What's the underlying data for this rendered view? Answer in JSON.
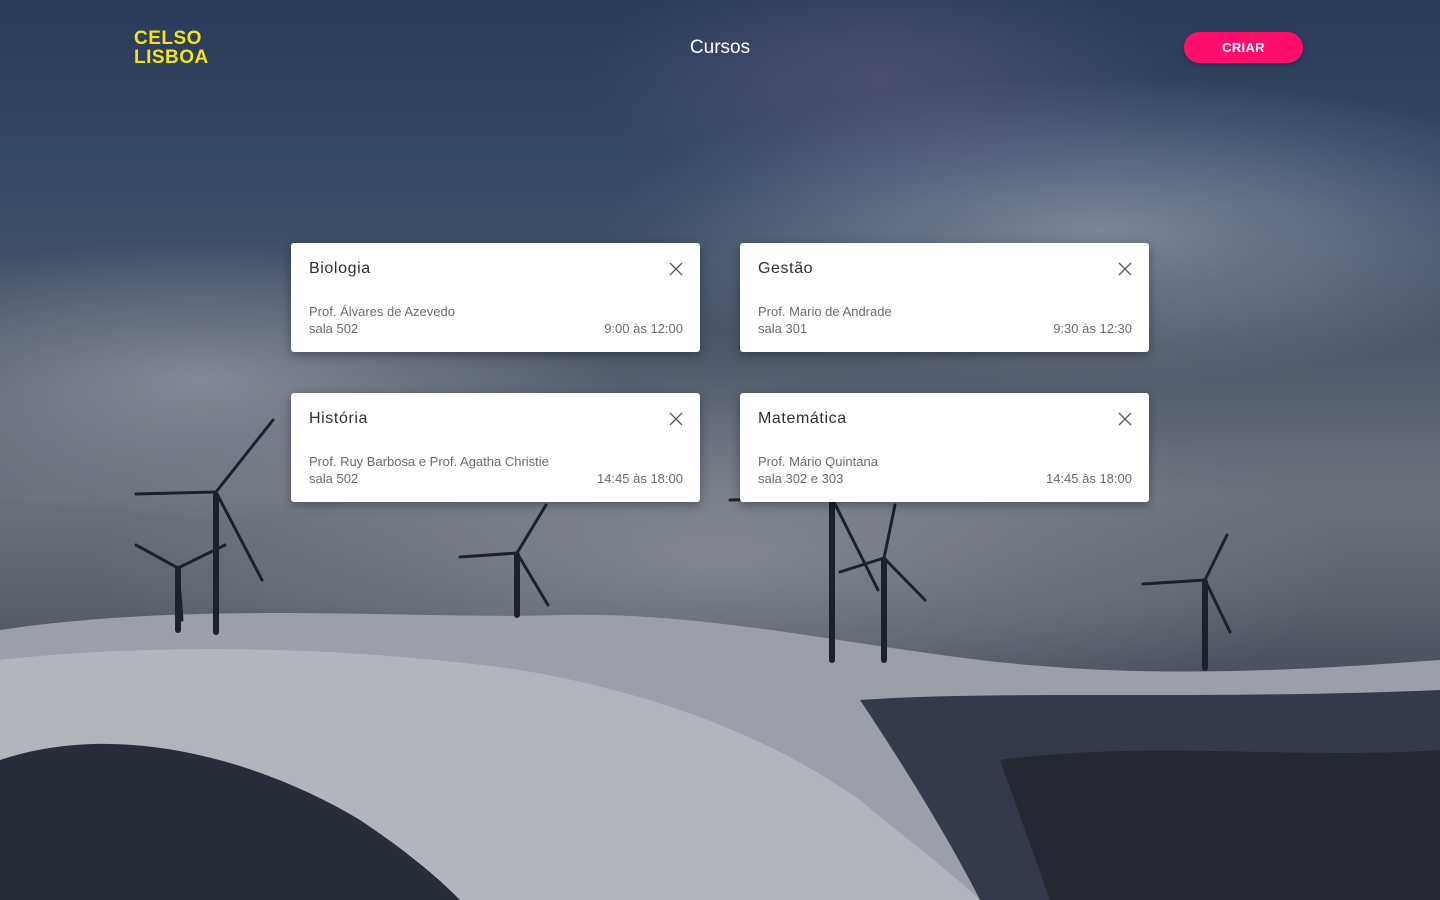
{
  "brand": {
    "line1": "CELSO",
    "line2": "LISBOA",
    "color": "#f2e31a"
  },
  "header": {
    "title": "Cursos",
    "create_label": "CRIAR",
    "accent": "#ff0f6b"
  },
  "courses": [
    {
      "title": "Biologia",
      "professor": "Prof. Álvares de Azevedo",
      "room": "sala 502",
      "time": "9:00 às 12:00"
    },
    {
      "title": "Gestão",
      "professor": "Prof. Mario de Andrade",
      "room": "sala 301",
      "time": "9:30 às 12:30"
    },
    {
      "title": "História",
      "professor": "Prof. Ruy Barbosa e Prof. Agatha Christie",
      "room": "sala 502",
      "time": "14:45 às 18:00"
    },
    {
      "title": "Matemática",
      "professor": "Prof. Mário Quintana",
      "room": "sala 302 e 303",
      "time": "14:45 às 18:00"
    }
  ],
  "icons": {
    "close": "close-icon"
  }
}
